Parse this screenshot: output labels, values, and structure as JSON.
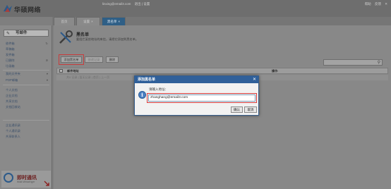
{
  "header": {
    "logo_text": "华硕网络",
    "user_email": "linxing@email3.com",
    "user_links": "退出 | 设置",
    "top_links": [
      "帮助",
      "反馈",
      "✕"
    ]
  },
  "tabs": [
    {
      "label": "首页"
    },
    {
      "label": "设置"
    },
    {
      "label": "黑名单"
    }
  ],
  "sidebar": {
    "compose_label": "写邮件",
    "items": [
      {
        "label": "收件箱"
      },
      {
        "label": "草稿箱"
      },
      {
        "label": "发件箱"
      },
      {
        "label": "已删除"
      },
      {
        "label": "垃圾箱"
      },
      {
        "label": "我的文件夹"
      },
      {
        "label": "POP邮箱"
      },
      {
        "label": "个人文档"
      },
      {
        "label": "企业文档"
      },
      {
        "label": "共享文档"
      },
      {
        "label": "文档回收站"
      },
      {
        "label": "企业通讯录"
      },
      {
        "label": "个人通讯录"
      },
      {
        "label": "共享联系人"
      }
    ],
    "im_title": "即时通讯",
    "im_subtitle": "iMail Messenger"
  },
  "main": {
    "page_title": "黑名单",
    "page_desc": "要阻拦某些地址的来信，请把它添加到黑名单。",
    "toolbar": {
      "add_label": "添加黑名单",
      "edit_label": "修改记录",
      "delete_label": "删除"
    },
    "table": {
      "col_addr": "邮件地址",
      "col_ops": "操作",
      "empty_text": "共0 记录 | 暂无记录 | 首页 | 上一页"
    }
  },
  "dialog": {
    "title": "添加黑名单",
    "close": "✕",
    "label": "请输入地址：",
    "input_value": "zhanghang@email3.com",
    "ok_label": "确认",
    "cancel_label": "取消"
  },
  "colors": {
    "accent": "#30609a",
    "highlight": "#d93b3b"
  }
}
